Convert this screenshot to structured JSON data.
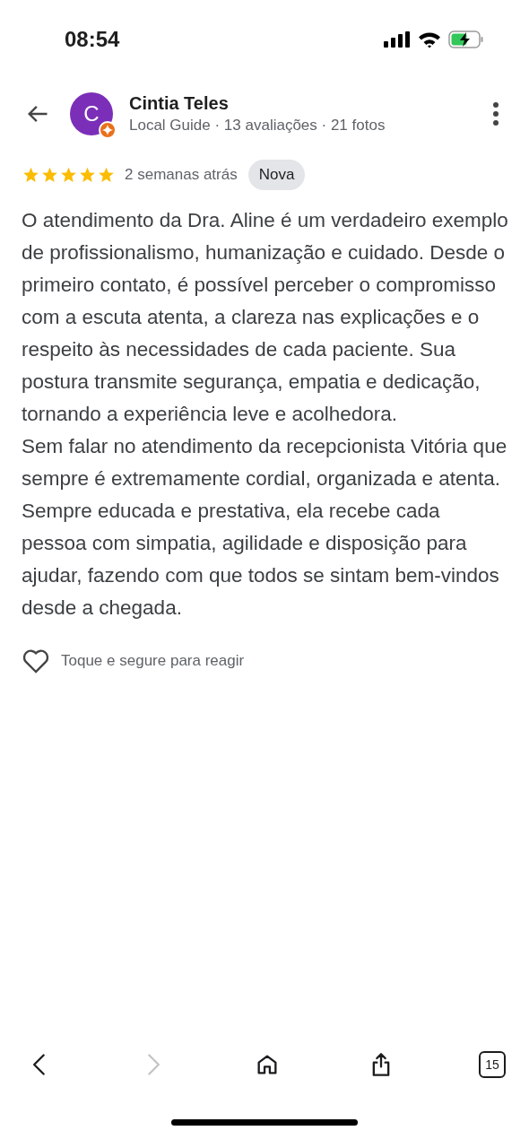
{
  "status_bar": {
    "time": "08:54"
  },
  "reviewer": {
    "initial": "C",
    "name": "Cintia Teles",
    "meta": "Local Guide · 13 avaliações · 21 fotos"
  },
  "review": {
    "stars": 5,
    "date": "2 semanas atrás",
    "badge": "Nova",
    "paragraphs": [
      "O atendimento da Dra. Aline é um verdadeiro exemplo de profissionalismo, humanização e cuidado. Desde o primeiro contato, é possível perceber o compromisso com a escuta atenta, a clareza nas explicações e o respeito às necessidades de cada paciente. Sua postura transmite segurança, empatia e dedicação, tornando a experiência leve e acolhedora.",
      "Sem falar no atendimento da recepcionista Vitória que sempre é extremamente cordial, organizada e atenta. Sempre educada e prestativa, ela recebe cada pessoa com simpatia, agilidade e disposição para ajudar, fazendo com que todos se sintam bem-vindos desde a chegada."
    ]
  },
  "reaction": {
    "hint": "Toque e segure para reagir"
  },
  "toolbar": [
    {
      "kind": "back",
      "disabled": false
    },
    {
      "kind": "forward",
      "disabled": true
    },
    {
      "kind": "home",
      "disabled": false
    },
    {
      "kind": "share",
      "disabled": false
    },
    {
      "kind": "tabs",
      "disabled": false,
      "count": "15"
    }
  ]
}
